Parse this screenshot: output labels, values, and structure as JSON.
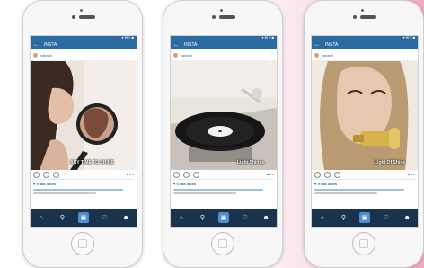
{
  "colors": {
    "brand_bar": "#2c6ba1",
    "tab_bar": "#19324d",
    "tab_active": "#4d8fd0"
  },
  "phones": [
    {
      "status": "▾ ✉ ≡ ■",
      "app_title": "INSTA",
      "username": "vabanii",
      "caption": "ANY TIME TO SHINE",
      "likes": "♥ 9 lika lubes",
      "photo": "woman-mirror"
    },
    {
      "status": "▾ ✉ ≡ ■",
      "app_title": "INSTA",
      "username": "vabanii",
      "caption": "Light Shines",
      "likes": "♥ 9 lika lubes",
      "photo": "vinyl-record"
    },
    {
      "status": "▾ ✉ ≡ ■",
      "app_title": "INSTA",
      "username": "vabanii",
      "caption": "Light Of Shine",
      "likes": "♥ 9 lika lubes",
      "photo": "woman-trumpet"
    }
  ],
  "tabs": [
    "home-icon",
    "search-icon",
    "camera-icon",
    "heart-icon",
    "profile-icon"
  ]
}
